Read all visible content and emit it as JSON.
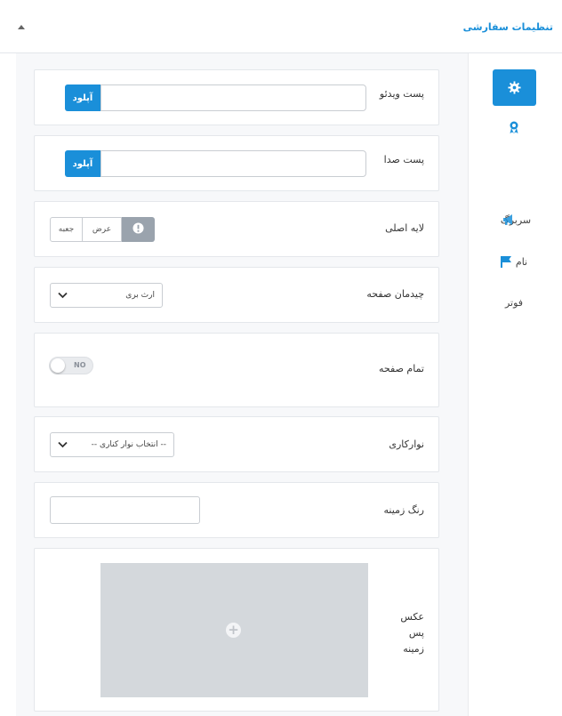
{
  "header": {
    "title": "تنظیمات سفارشی"
  },
  "sidebar": {
    "items": [
      {
        "label": "",
        "icon": "gear-icon",
        "active": true
      },
      {
        "label": "",
        "icon": "award-icon",
        "active": false
      },
      {
        "label": "سربرگ",
        "icon": "megaphone-icon",
        "active": false
      },
      {
        "label": "نام",
        "icon": "flag-icon",
        "active": false
      },
      {
        "label": "فوتر",
        "icon": "",
        "active": false
      }
    ]
  },
  "fields": {
    "video_post": {
      "label": "پست ویدئو",
      "button": "آپلود"
    },
    "audio_post": {
      "label": "پست صدا",
      "button": "آپلود"
    },
    "main_layer": {
      "label": "لایه اصلی",
      "options": [
        "جعبه",
        "عرض"
      ],
      "selected_icon": "info-icon"
    },
    "page_layout": {
      "label": "چیدمان صفحه",
      "value": "ارث بری"
    },
    "full_page": {
      "label": "تمام صفحه",
      "toggle": "NO"
    },
    "slider": {
      "label": "نوارکاری",
      "value": "-- انتخاب نوار کناری --"
    },
    "bg_color": {
      "label": "رنگ زمینه",
      "value": ""
    },
    "bg_image": {
      "label": "عکس پس زمینه"
    }
  },
  "colors": {
    "accent": "#1a8fd9",
    "segment_selected": "#9aa3ad"
  }
}
